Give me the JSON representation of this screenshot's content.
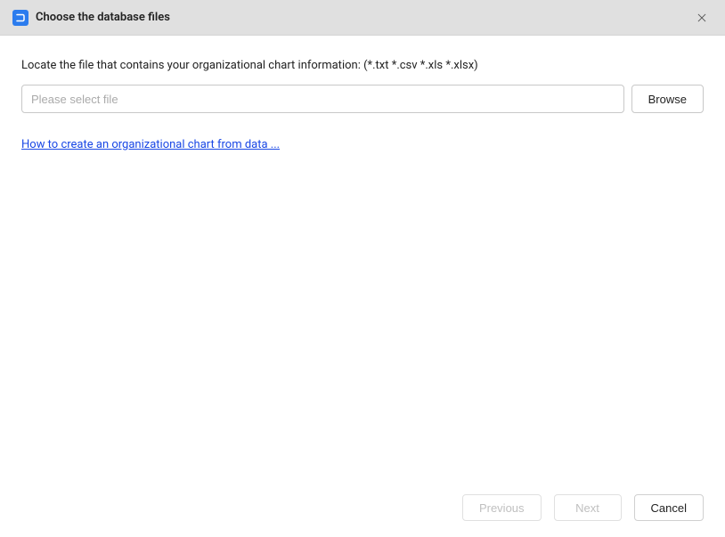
{
  "header": {
    "title": "Choose the database files"
  },
  "main": {
    "instruction": "Locate the file that contains your organizational chart information: (*.txt *.csv *.xls *.xlsx)",
    "file_input_placeholder": "Please select file",
    "file_input_value": "",
    "browse_label": "Browse",
    "help_link": "How to create an organizational chart from data ..."
  },
  "footer": {
    "previous_label": "Previous",
    "next_label": "Next",
    "cancel_label": "Cancel"
  }
}
